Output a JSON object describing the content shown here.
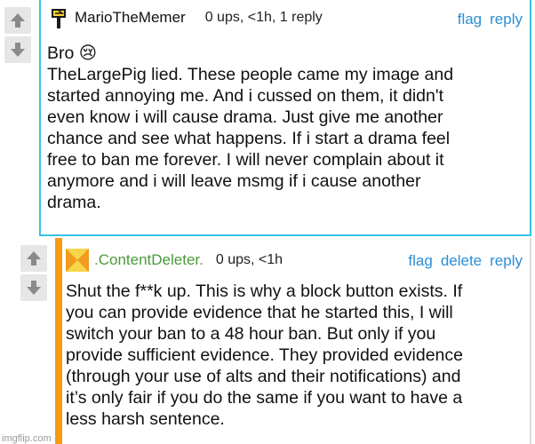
{
  "comments": [
    {
      "username": "MarioTheMemer",
      "meta": "0 ups, <1h, 1 reply",
      "actions": [
        "flag",
        "reply"
      ],
      "body_lines": [
        "Bro 😢",
        "TheLargePig lied. These people came my image and",
        "started annoying me. And i cussed on them, it didn't",
        "even know i will cause drama. Just give me another",
        "chance and see what happens. If i start a drama feel",
        "free to ban me forever. I will never complain about it",
        "anymore and i will leave msmg if i cause another",
        "drama."
      ],
      "accent_color": "#34c3e6"
    },
    {
      "username": ".ContentDeleter.",
      "meta": "0 ups, <1h",
      "actions": [
        "flag",
        "delete",
        "reply"
      ],
      "body_lines": [
        "Shut the f**k up. This is why a block button exists. If",
        "you can provide evidence that he started this, I will",
        "switch your ban to a 48 hour ban. But only if you",
        "provide sufficient evidence. They provided evidence",
        "(through your use of alts and their notifications) and",
        "it’s only fair if you do the same if you want to have a",
        "less harsh sentence."
      ],
      "username_color": "#4a9a3a",
      "accent_color": "#f39c12"
    }
  ],
  "watermark": "imgflip.com"
}
